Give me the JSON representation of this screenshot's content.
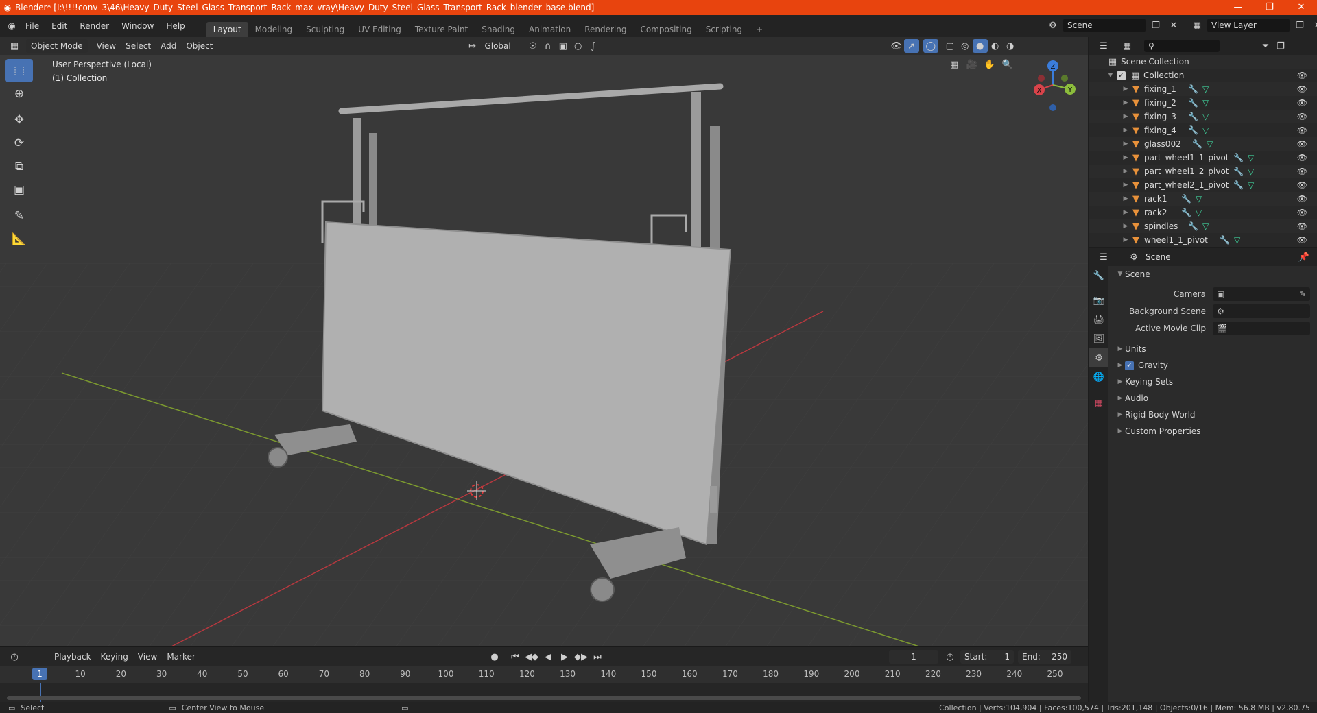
{
  "window": {
    "title": "Blender* [I:\\!!!!conv_3\\46\\Heavy_Duty_Steel_Glass_Transport_Rack_max_vray\\Heavy_Duty_Steel_Glass_Transport_Rack_blender_base.blend]",
    "minimize": "—",
    "maximize": "❐",
    "close": "✕"
  },
  "menu": [
    "File",
    "Edit",
    "Render",
    "Window",
    "Help"
  ],
  "workspaces": [
    "Layout",
    "Modeling",
    "Sculpting",
    "UV Editing",
    "Texture Paint",
    "Shading",
    "Animation",
    "Rendering",
    "Compositing",
    "Scripting"
  ],
  "workspace_add": "+",
  "scene_selector": {
    "value": "Scene"
  },
  "view_layer_selector": {
    "value": "View Layer"
  },
  "viewport": {
    "mode": "Object Mode",
    "menus": [
      "View",
      "Select",
      "Add",
      "Object"
    ],
    "transform_orientation": "Global",
    "info_line1": "User Perspective (Local)",
    "info_line2": "(1) Collection",
    "gizmo": {
      "x": "X",
      "y": "Y",
      "z": "Z"
    }
  },
  "timeline": {
    "menus": [
      "Playback",
      "Keying",
      "View",
      "Marker"
    ],
    "current_frame": "1",
    "start_label": "Start:",
    "start": "1",
    "end_label": "End:",
    "end": "250",
    "ruler_current": "1",
    "ruler": [
      "10",
      "20",
      "30",
      "40",
      "50",
      "60",
      "70",
      "80",
      "90",
      "100",
      "110",
      "120",
      "130",
      "140",
      "150",
      "160",
      "170",
      "180",
      "190",
      "200",
      "210",
      "220",
      "230",
      "240",
      "250"
    ]
  },
  "outliner": {
    "scene_collection": "Scene Collection",
    "collection": "Collection",
    "items": [
      "fixing_1",
      "fixing_2",
      "fixing_3",
      "fixing_4",
      "glass002",
      "part_wheel1_1_pivot",
      "part_wheel1_2_pivot",
      "part_wheel2_1_pivot",
      "rack1",
      "rack2",
      "spindles",
      "wheel1_1_pivot"
    ]
  },
  "properties": {
    "header": "Scene",
    "panel": "Scene",
    "camera_label": "Camera",
    "background_scene_label": "Background Scene",
    "active_movie_clip_label": "Active Movie Clip",
    "sections": [
      "Units",
      "Gravity",
      "Keying Sets",
      "Audio",
      "Rigid Body World",
      "Custom Properties"
    ]
  },
  "statusbar": {
    "select": "Select",
    "center_view": "Center View to Mouse",
    "stats": "Collection | Verts:104,904 | Faces:100,574 | Tris:201,148 | Objects:0/16 | Mem: 56.8 MB | v2.80.75"
  },
  "colors": {
    "titlebar": "#e8440e",
    "accent": "#4772b3",
    "x_axis": "#d9434a",
    "y_axis": "#8cbd3c",
    "z_axis": "#3b7ddb"
  }
}
